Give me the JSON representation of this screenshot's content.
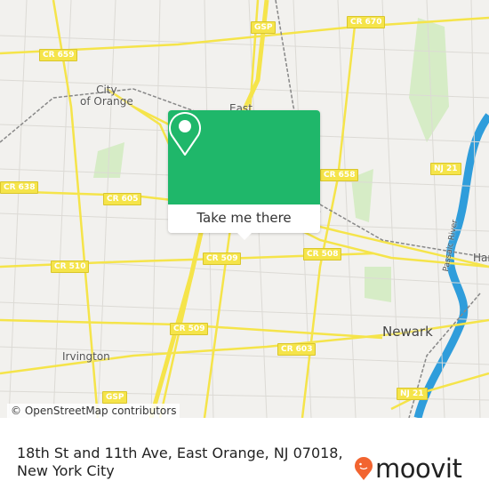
{
  "map": {
    "places": {
      "orange": "City\nof Orange",
      "east": "East",
      "irvington": "Irvington",
      "newark": "Newark",
      "harrison": "Har",
      "river": "Passaic River"
    },
    "shields": [
      "CR 659",
      "GSP",
      "CR 670",
      "CR 638",
      "CR 605",
      "CR 658",
      "NJ 21",
      "CR 510",
      "CR 509",
      "CR 508",
      "CR 509",
      "CR 603",
      "NJ 21",
      "GSP"
    ],
    "attribution": "© OpenStreetMap contributors",
    "colors": {
      "land": "#f2f1ee",
      "road": "#f5e44a",
      "water": "#2f9ddb",
      "park": "#d6ecc6",
      "rail": "#888888"
    }
  },
  "popup": {
    "icon": "map-pin-icon",
    "button_label": "Take me there",
    "color": "#1fb76a"
  },
  "footer": {
    "address": "18th St and 11th Ave, East Orange, NJ 07018, New York City",
    "logo_text": "moovit",
    "logo_color": "#f26430"
  }
}
